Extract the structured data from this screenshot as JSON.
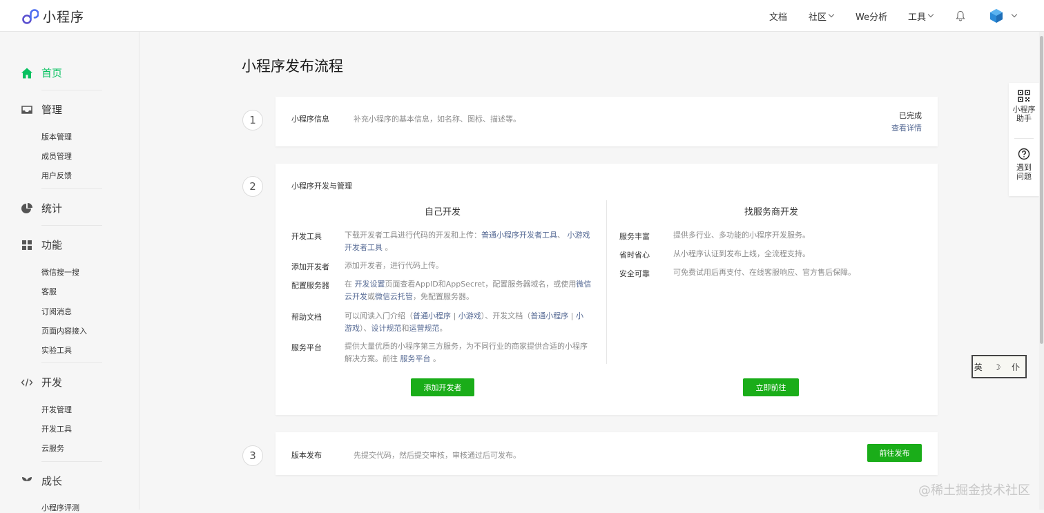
{
  "header": {
    "logo_text": "小程序",
    "nav": {
      "docs": "文档",
      "community": "社区",
      "we_analytics": "We分析",
      "tools": "工具"
    }
  },
  "sidebar": {
    "home": "首页",
    "manage": "管理",
    "manage_items": [
      "版本管理",
      "成员管理",
      "用户反馈"
    ],
    "stats": "统计",
    "features": "功能",
    "features_items": [
      "微信搜一搜",
      "客服",
      "订阅消息",
      "页面内容接入",
      "实验工具"
    ],
    "develop": "开发",
    "develop_items": [
      "开发管理",
      "开发工具",
      "云服务"
    ],
    "growth": "成长",
    "growth_items": [
      "小程序评测"
    ]
  },
  "main": {
    "title": "小程序发布流程",
    "step1": {
      "num": "1",
      "label": "小程序信息",
      "desc": "补充小程序的基本信息，如名称、图标、描述等。",
      "status": "已完成",
      "detail_link": "查看详情"
    },
    "step2": {
      "num": "2",
      "label": "小程序开发与管理",
      "self_dev": {
        "title": "自己开发",
        "rows": {
          "tools_label": "开发工具",
          "tools_text1": "下载开发者工具进行代码的开发和上传：",
          "tools_link1": "普通小程序开发者工具",
          "tools_sep": "、",
          "tools_link2a": "小游戏",
          "tools_link2b": "开发者工具",
          "tools_end": "。",
          "adddev_label": "添加开发者",
          "adddev_text": "添加开发者，进行代码上传。",
          "server_label": "配置服务器",
          "server_t1": "在",
          "server_link1": "开发设置",
          "server_t2": "页面查看AppID和AppSecret，配置服务器域名，或使用",
          "server_link2a": "微信",
          "server_link2b": "云开发",
          "server_t3": "或",
          "server_link3": "微信云托管",
          "server_t4": "，免配置服务器。",
          "help_label": "帮助文档",
          "help_t1": "可以阅读入门介绍（",
          "help_l1": "普通小程序",
          "help_bar": "|",
          "help_l2": "小游戏",
          "help_t2": "）、开发文档（",
          "help_l3": "普通小程序",
          "help_l4a": "小",
          "help_l4b": "游戏",
          "help_t3": "）、",
          "help_l5": "设计规范",
          "help_t4": "和",
          "help_l6": "运营规范",
          "help_t5": "。",
          "platform_label": "服务平台",
          "platform_t1": "提供大量优质的小程序第三方服务，为不同行业的商家提供合适的小程序",
          "platform_t2": "解决方案。前往",
          "platform_link": "服务平台",
          "platform_end": "。"
        },
        "button": "添加开发者"
      },
      "vendor_dev": {
        "title": "找服务商开发",
        "rows": [
          {
            "label": "服务丰富",
            "text": "提供多行业、多功能的小程序开发服务。"
          },
          {
            "label": "省时省心",
            "text": "从小程序认证到发布上线，全流程支持。"
          },
          {
            "label": "安全可靠",
            "text": "可免费试用后再支付、在线客服响应、官方售后保障。"
          }
        ],
        "button": "立即前往"
      }
    },
    "step3": {
      "num": "3",
      "label": "版本发布",
      "desc": "先提交代码，然后提交审核，审核通过后可发布。",
      "button": "前往发布"
    }
  },
  "right_panel": {
    "assistant_l1": "小程序",
    "assistant_l2": "助手",
    "help_l1": "遇到",
    "help_l2": "问题"
  },
  "stamp_text": "英 ☽ 仆",
  "watermark": "@稀土掘金技术社区",
  "colors": {
    "accent_green": "#07c160",
    "button_green": "#1aad19",
    "link_blue": "#576b95"
  }
}
